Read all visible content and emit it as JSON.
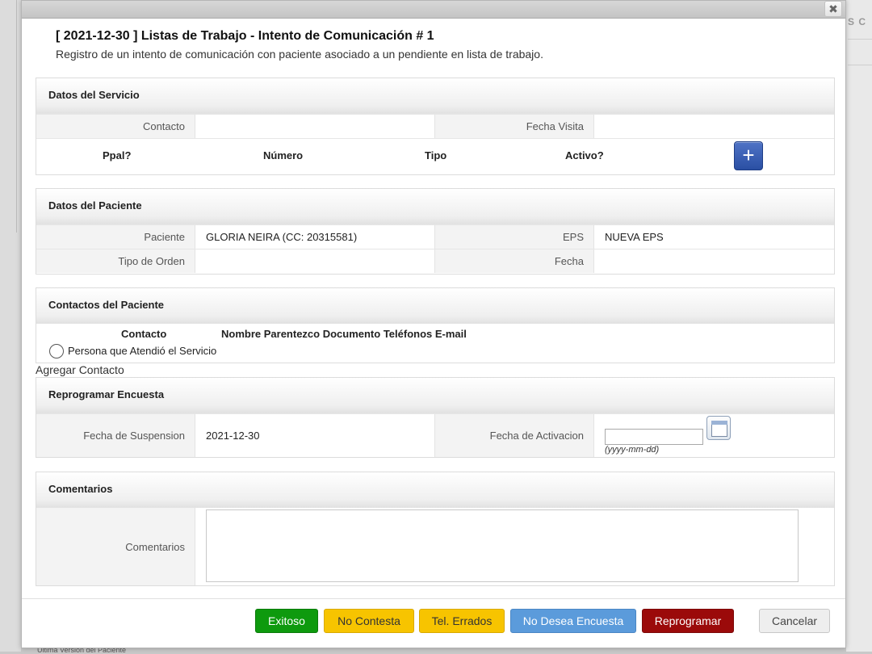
{
  "background": {
    "tab_text": "S C",
    "bottom_text": "Ultima Versión del Paciente"
  },
  "dialog": {
    "close_glyph": "✖",
    "title": "[ 2021-12-30 ] Listas de Trabajo - Intento de Comunicación # 1",
    "subtitle": "Registro de un intento de comunicación con paciente asociado a un pendiente en lista de trabajo."
  },
  "servicio": {
    "heading": "Datos del Servicio",
    "contacto_label": "Contacto",
    "contacto_value": "",
    "fecha_visita_label": "Fecha Visita",
    "fecha_visita_value": "",
    "phones_headers": [
      "Ppal?",
      "Número",
      "Tipo",
      "Activo?"
    ],
    "add_glyph": "+"
  },
  "paciente": {
    "heading": "Datos del Paciente",
    "paciente_label": "Paciente",
    "paciente_value": "GLORIA NEIRA (CC: 20315581)",
    "eps_label": "EPS",
    "eps_value": "NUEVA EPS",
    "tipo_orden_label": "Tipo de Orden",
    "tipo_orden_value": "",
    "fecha_label": "Fecha",
    "fecha_value": ""
  },
  "contactos": {
    "heading": "Contactos del Paciente",
    "col_contacto": "Contacto",
    "col_rest": "Nombre Parentezco Documento Teléfonos E-mail",
    "radio_label": "Persona que Atendió el Servicio",
    "agregar": "Agregar Contacto"
  },
  "reprogramar": {
    "heading": "Reprogramar Encuesta",
    "suspension_label": "Fecha de Suspension",
    "suspension_value": "2021-12-30",
    "activacion_label": "Fecha de Activacion",
    "activacion_value": "",
    "activacion_hint": "(yyyy-mm-dd)"
  },
  "comentarios": {
    "heading": "Comentarios",
    "label": "Comentarios",
    "value": ""
  },
  "buttons": {
    "exitoso": "Exitoso",
    "no_contesta": "No Contesta",
    "tel_errados": "Tel. Errados",
    "no_desea": "No Desea Encuesta",
    "reprogramar": "Reprogramar",
    "cancelar": "Cancelar"
  },
  "colors": {
    "exitoso": "#0e9a0e",
    "no_contesta": "#f7c400",
    "tel_errados": "#f7c400",
    "no_desea": "#5b9bdb",
    "reprogramar": "#9b0a0a",
    "cancelar": "#eeeeee",
    "add_button": "#2f56ad"
  }
}
